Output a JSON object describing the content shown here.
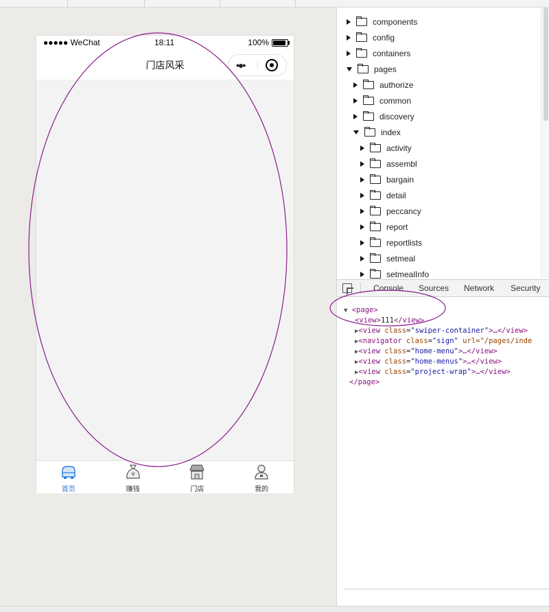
{
  "phone": {
    "carrier": "●●●●● WeChat",
    "time": "18:11",
    "battery": "100%",
    "title": "门店风采",
    "capsule_dots": "•●•"
  },
  "tabbar": [
    {
      "label": "首页",
      "icon": "car-icon",
      "active": true
    },
    {
      "label": "赚钱",
      "icon": "money-bag-icon",
      "active": false
    },
    {
      "label": "门店",
      "icon": "store-icon",
      "active": false
    },
    {
      "label": "我的",
      "icon": "user-icon",
      "active": false
    }
  ],
  "tree": [
    {
      "label": "components",
      "expanded": false
    },
    {
      "label": "config",
      "expanded": false
    },
    {
      "label": "containers",
      "expanded": false
    },
    {
      "label": "pages",
      "expanded": true
    },
    {
      "label": "authorize",
      "expanded": false
    },
    {
      "label": "common",
      "expanded": false
    },
    {
      "label": "discovery",
      "expanded": false
    },
    {
      "label": "index",
      "expanded": true
    },
    {
      "label": "activity",
      "expanded": false
    },
    {
      "label": "assembl",
      "expanded": false
    },
    {
      "label": "bargain",
      "expanded": false
    },
    {
      "label": "detail",
      "expanded": false
    },
    {
      "label": "peccancy",
      "expanded": false
    },
    {
      "label": "report",
      "expanded": false
    },
    {
      "label": "reportlists",
      "expanded": false
    },
    {
      "label": "setmeal",
      "expanded": false
    },
    {
      "label": "setmealInfo",
      "expanded": false
    }
  ],
  "devtools_tabs": [
    "Console",
    "Sources",
    "Network",
    "Security"
  ],
  "elements": {
    "page_open": "<page>",
    "view_open": "<view>",
    "view_text": "111",
    "view_close": "</view>",
    "children": [
      {
        "class": "swiper-container",
        "extra": ""
      },
      {
        "class": "sign",
        "extra": "url=\"/pages/inde",
        "tag": "navigator"
      },
      {
        "class": "home-menu",
        "extra": ""
      },
      {
        "class": "home-menus",
        "extra": ""
      },
      {
        "class": "project-wrap",
        "extra": ""
      }
    ],
    "page_close": "</page>"
  },
  "colors": {
    "annotation": "#8a1a8a",
    "tab_active": "#2b7fd8"
  }
}
